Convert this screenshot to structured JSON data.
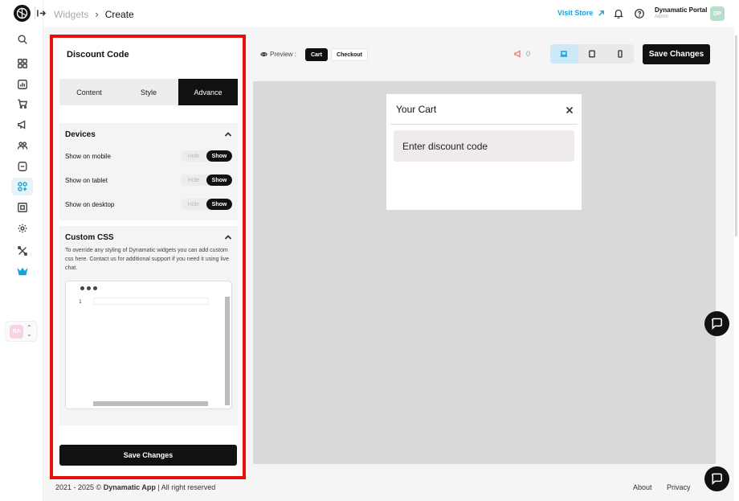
{
  "header": {
    "breadcrumb": {
      "parent": "Widgets",
      "separator": "›",
      "current": "Create"
    },
    "visit_store": "Visit Store",
    "profile": {
      "name": "Dynamatic Portal",
      "role": "Admin",
      "initials": "DP"
    }
  },
  "sidebar": {
    "icons": [
      "search-icon",
      "grid-icon",
      "chart-icon",
      "cart-icon",
      "megaphone-icon",
      "users-icon",
      "list-icon",
      "widgets-icon",
      "scan-icon",
      "settings-icon",
      "tools-icon",
      "crown-icon"
    ],
    "active": "widgets-icon",
    "user_initials": "RA"
  },
  "panel": {
    "title": "Discount Code",
    "tabs": [
      {
        "label": "Content",
        "active": false
      },
      {
        "label": "Style",
        "active": false
      },
      {
        "label": "Advance",
        "active": true
      }
    ],
    "devices": {
      "title": "Devices",
      "rows": [
        {
          "label": "Show on mobile",
          "hide": "Hide",
          "show": "Show",
          "value": "Show"
        },
        {
          "label": "Show on tablet",
          "hide": "Hide",
          "show": "Show",
          "value": "Show"
        },
        {
          "label": "Show on desktop",
          "hide": "Hide",
          "show": "Show",
          "value": "Show"
        }
      ]
    },
    "custom_css": {
      "title": "Custom CSS",
      "description": "To override any styling of Dynamatic widgets you can add custom css here. Contact us for additional support if you need it using live chat.",
      "line_number": "1"
    },
    "save_label": "Save Changes"
  },
  "preview": {
    "label": "Preview :",
    "tabs": [
      {
        "label": "Cart",
        "active": true
      },
      {
        "label": "Checkout",
        "active": false
      }
    ],
    "likes": "0",
    "device_active": "desktop",
    "save_label": "Save Changes",
    "cart": {
      "title": "Your Cart",
      "discount_placeholder": "Enter discount code"
    }
  },
  "footer": {
    "copy_prefix": "2021 - 2025 ©",
    "brand": "Dynamatic App",
    "copy_suffix": "| All right reserved",
    "links": [
      "About",
      "Privacy"
    ]
  },
  "colors": {
    "accent": "#1aa0d8",
    "highlight_frame": "#e41111",
    "primary_button": "#111111"
  }
}
